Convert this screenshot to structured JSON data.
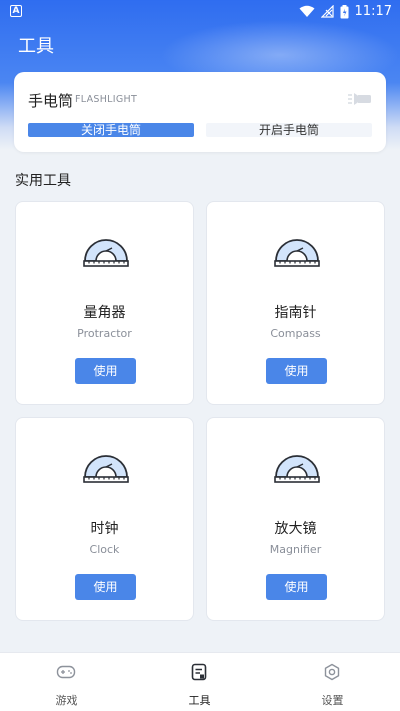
{
  "status_bar": {
    "time": "11:17",
    "left_icon_letter": "A"
  },
  "header": {
    "title": "工具"
  },
  "flashlight": {
    "title": "手电筒",
    "subtitle": "FLASHLIGHT",
    "off_label": "关闭手电筒",
    "on_label": "开启手电筒",
    "active_color": "#4a86e8"
  },
  "section": {
    "title": "实用工具"
  },
  "tools": [
    {
      "name": "量角器",
      "en": "Protractor",
      "button": "使用"
    },
    {
      "name": "指南针",
      "en": "Compass",
      "button": "使用"
    },
    {
      "name": "时钟",
      "en": "Clock",
      "button": "使用"
    },
    {
      "name": "放大镜",
      "en": "Magnifier",
      "button": "使用"
    }
  ],
  "nav": [
    {
      "label": "游戏",
      "icon": "gamepad-icon"
    },
    {
      "label": "工具",
      "icon": "tools-icon",
      "active": true
    },
    {
      "label": "设置",
      "icon": "settings-icon"
    }
  ],
  "colors": {
    "primary": "#4a86e8",
    "header_blue": "#2f6df0"
  }
}
